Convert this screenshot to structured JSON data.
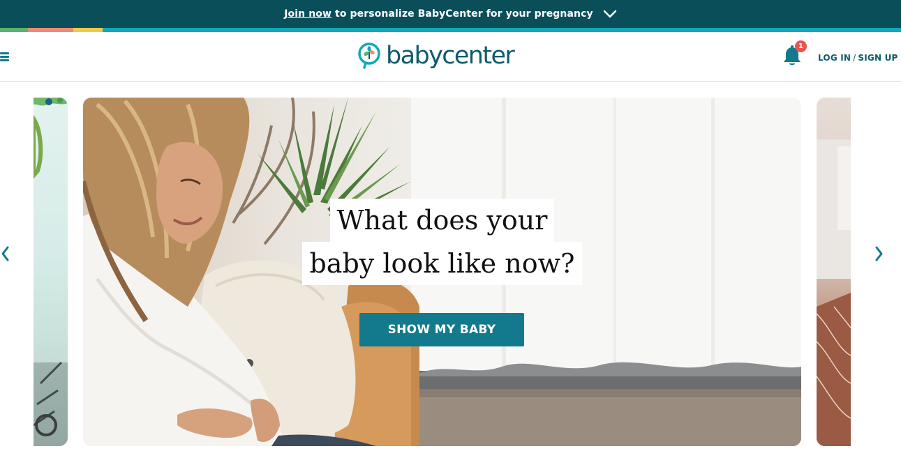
{
  "promo": {
    "join_label": "Join now",
    "message": "to personalize BabyCenter for your pregnancy",
    "chevron_icon": "chevron-down-icon"
  },
  "header": {
    "menu_icon": "hamburger-menu-icon",
    "logo_text": "babycenter",
    "notification_count": "1",
    "login_label": "LOG IN",
    "separator": "/",
    "signup_label": "SIGN UP"
  },
  "hero": {
    "title_line1": "What does your",
    "title_line2": "baby look like now?",
    "cta_label": "SHOW MY BABY"
  },
  "carousel": {
    "prev_icon": "chevron-left-icon",
    "next_icon": "chevron-right-icon"
  },
  "colors": {
    "brand_dark": "#0a4e5a",
    "brand_teal": "#127a8c",
    "badge_red": "#e8554e",
    "stripe": [
      "#5bb36b",
      "#ef8a73",
      "#f4c84a",
      "#12a8ba"
    ]
  }
}
